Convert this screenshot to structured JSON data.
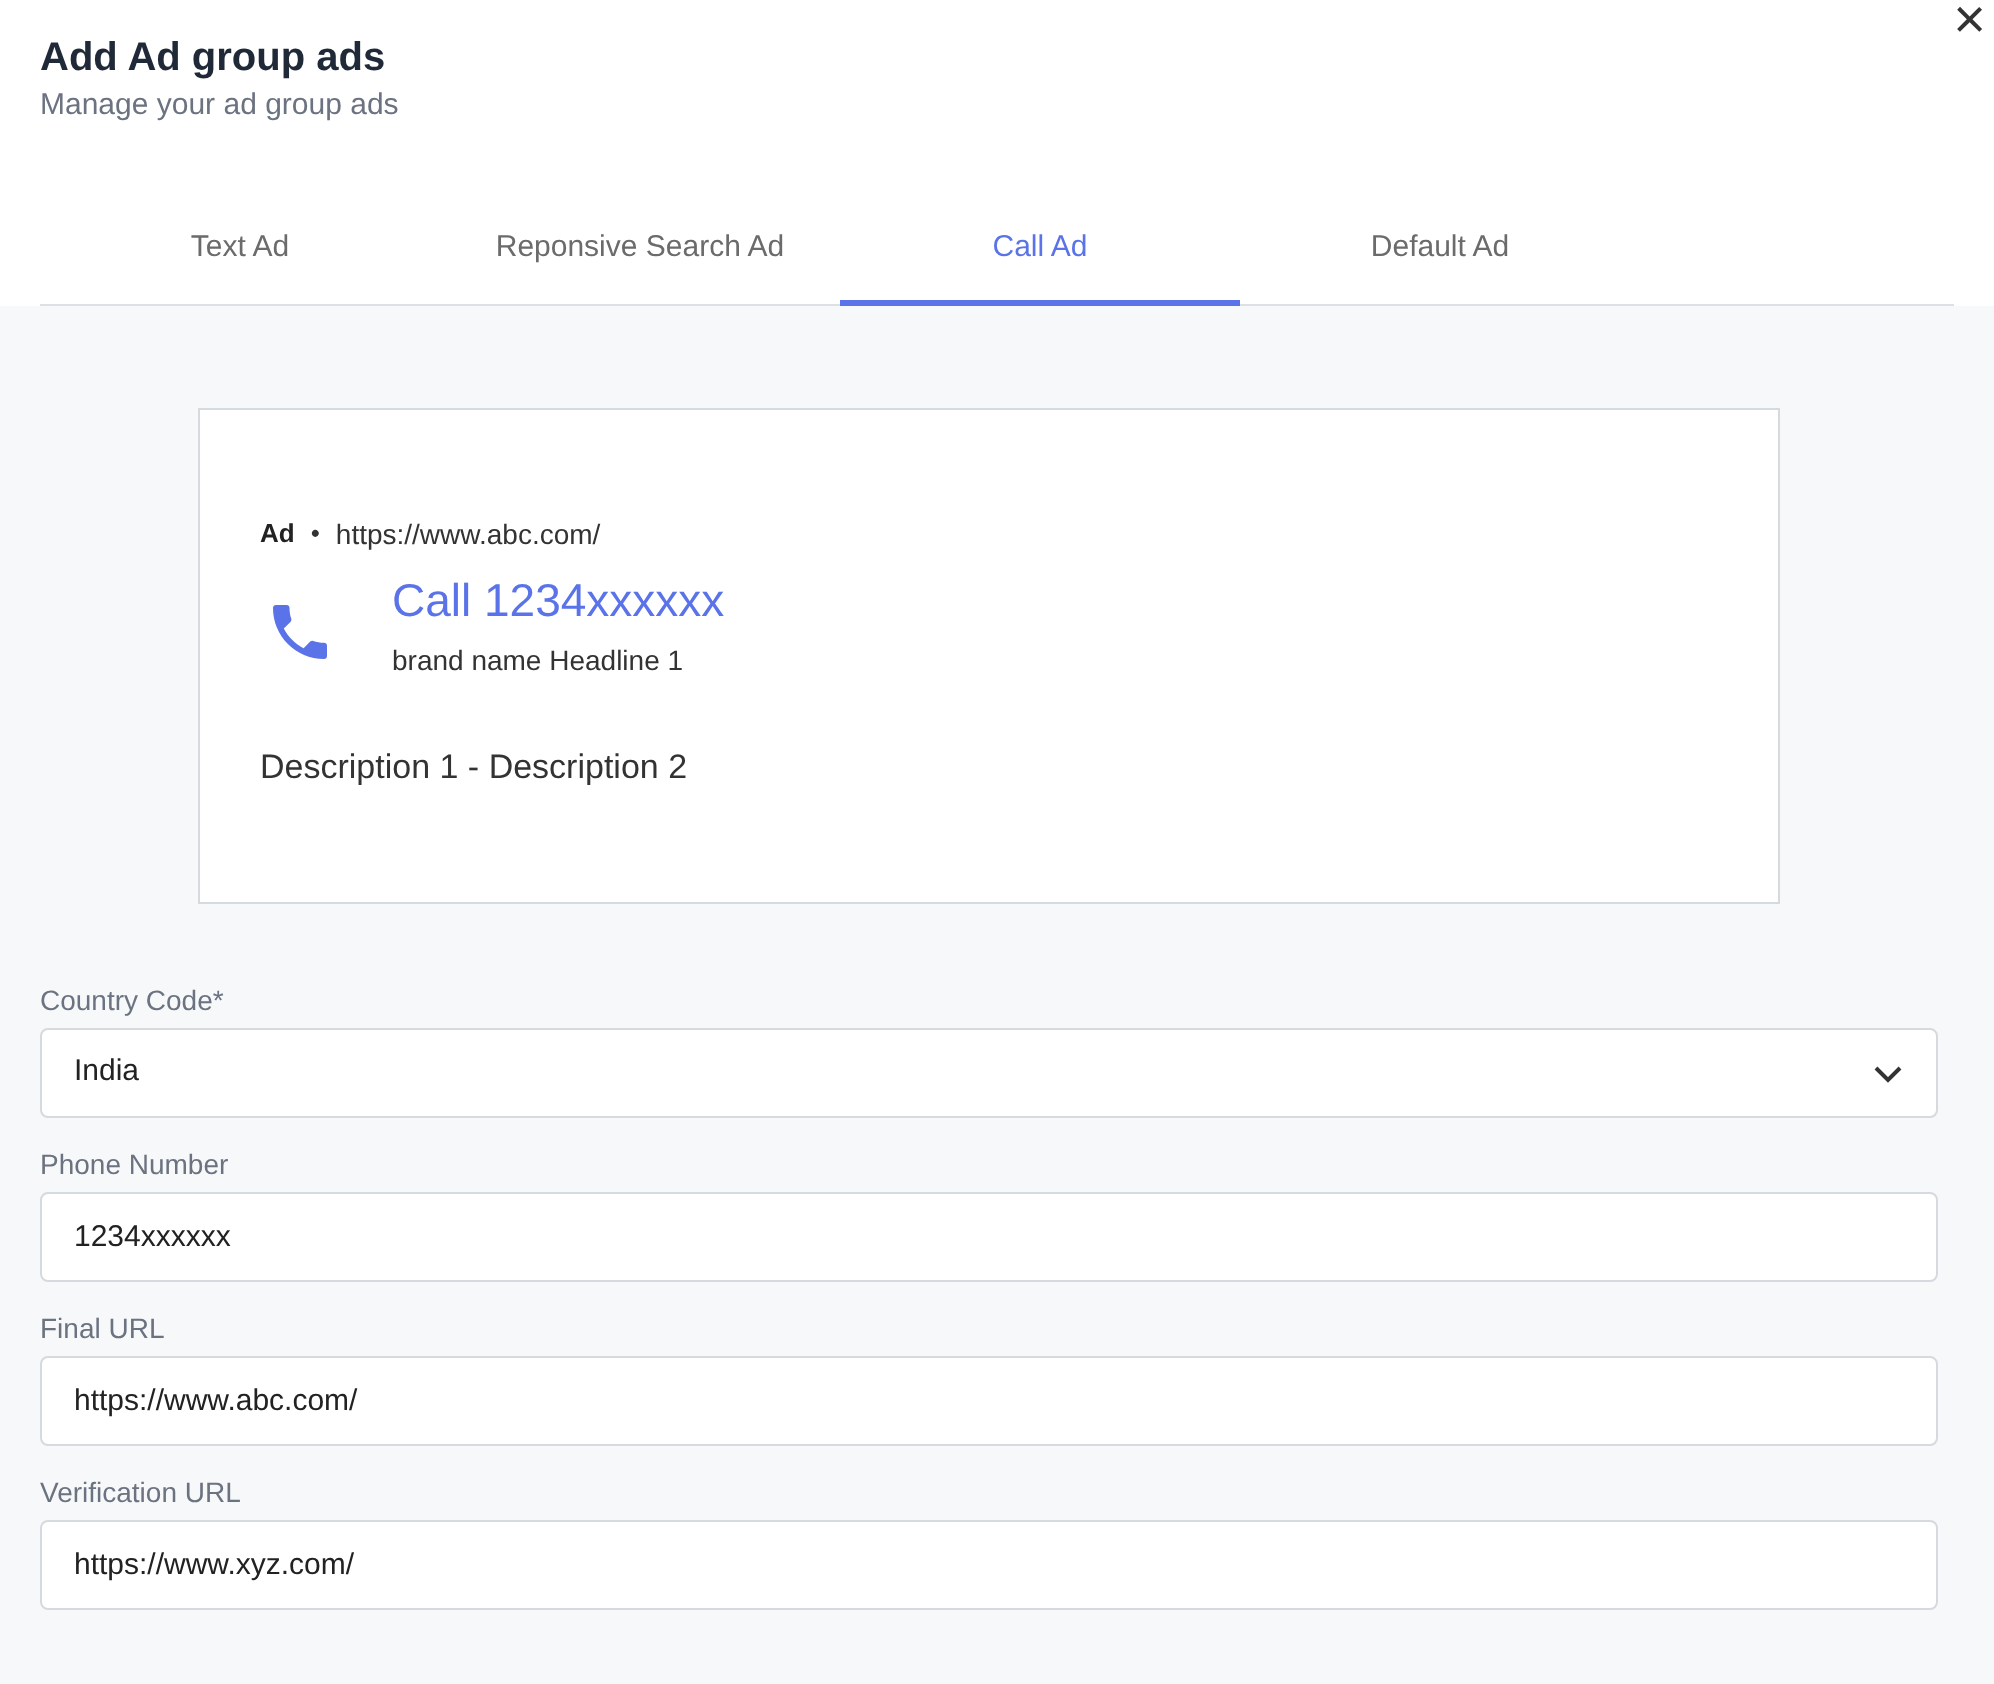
{
  "header": {
    "title": "Add Ad group ads",
    "subtitle": "Manage your ad group ads",
    "close": "×"
  },
  "tabs": [
    {
      "label": "Text Ad",
      "selected": false
    },
    {
      "label": "Reponsive Search Ad",
      "selected": false
    },
    {
      "label": "Call Ad",
      "selected": true
    },
    {
      "label": "Default Ad",
      "selected": false
    }
  ],
  "preview": {
    "badge": "Ad",
    "separator": "•",
    "url": "https://www.abc.com/",
    "headline": "Call 1234xxxxxx",
    "brand": "brand name Headline 1",
    "description": "Description 1 - Description 2"
  },
  "fields": [
    {
      "kind": "select",
      "label": "Country Code*",
      "value": "India"
    },
    {
      "kind": "input",
      "label": "Phone Number",
      "value": "1234xxxxxx"
    },
    {
      "kind": "input",
      "label": "Final URL",
      "value": "https://www.abc.com/"
    },
    {
      "kind": "input",
      "label": "Verification URL",
      "value": "https://www.xyz.com/"
    }
  ]
}
